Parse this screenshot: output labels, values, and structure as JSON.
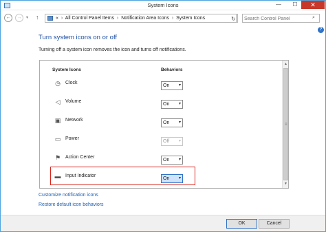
{
  "window": {
    "title": "System Icons",
    "minimize": "—",
    "maximize": "☐",
    "close": "✕"
  },
  "nav": {
    "back": "←",
    "forward": "→",
    "recent": "▾",
    "up": "↑",
    "address_prefix": "«",
    "breadcrumbs": [
      "All Control Panel Items",
      "Notification Area Icons",
      "System Icons"
    ],
    "separator": "›",
    "dropdown": "▾",
    "refresh": "↻",
    "search_placeholder": "Search Control Panel",
    "search_glyph": "⌕"
  },
  "help": "?",
  "heading": "Turn system icons on or off",
  "description": "Turning off a system icon removes the icon and turns off notifications.",
  "table": {
    "col_icons": "System Icons",
    "col_behaviors": "Behaviors",
    "rows": [
      {
        "label": "Clock",
        "value": "On",
        "icon": "clock-icon",
        "glyph": "◷"
      },
      {
        "label": "Volume",
        "value": "On",
        "icon": "speaker-icon",
        "glyph": "◁"
      },
      {
        "label": "Network",
        "value": "On",
        "icon": "network-icon",
        "glyph": "▣"
      },
      {
        "label": "Power",
        "value": "Off",
        "icon": "power-icon",
        "glyph": "▭"
      },
      {
        "label": "Action Center",
        "value": "On",
        "icon": "flag-icon",
        "glyph": "⚑"
      },
      {
        "label": "Input Indicator",
        "value": "On",
        "icon": "keyboard-icon",
        "glyph": "▬"
      }
    ],
    "dropdown_glyph": "▾"
  },
  "scrollbar": {
    "up": "▲",
    "down": "▼",
    "grip": "≡"
  },
  "links": {
    "customize": "Customize notification icons",
    "restore": "Restore default icon behaviors"
  },
  "buttons": {
    "ok": "OK",
    "cancel": "Cancel"
  },
  "colors": {
    "heading": "#1e4fa3",
    "link": "#1f5fb4",
    "highlight": "#d9261c",
    "close_button": "#c7382a"
  }
}
